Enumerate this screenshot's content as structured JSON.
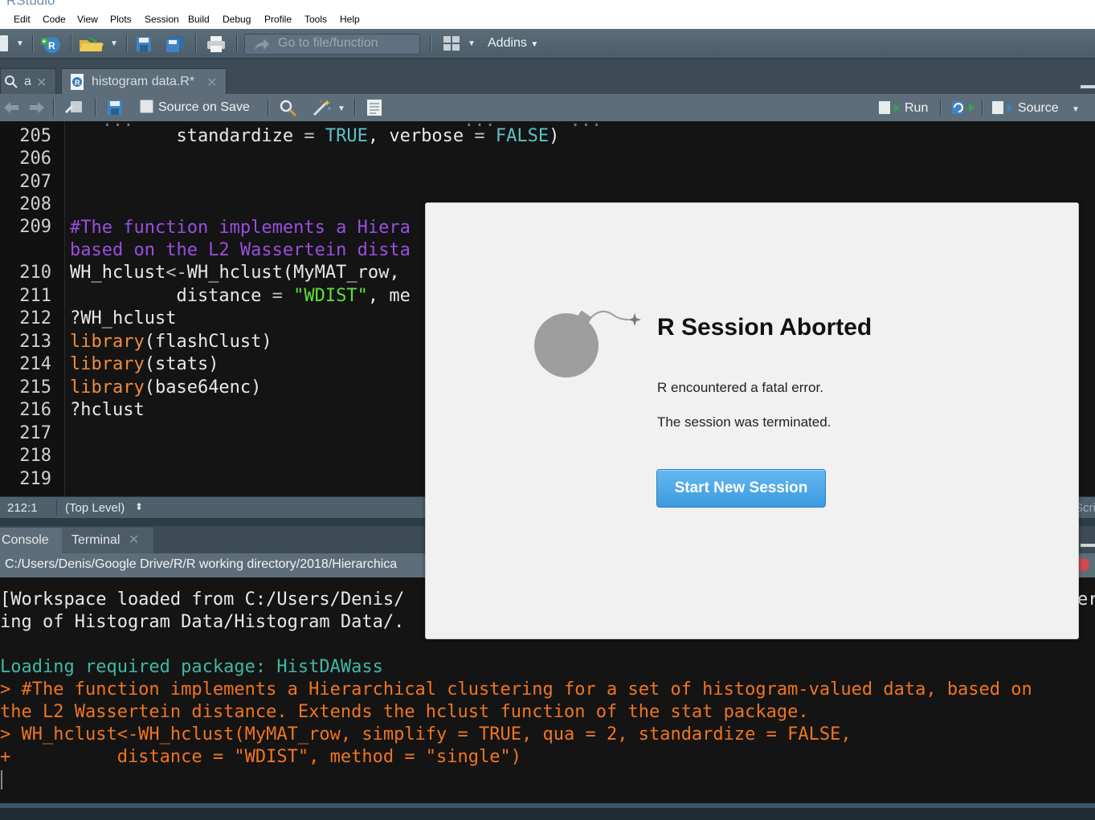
{
  "app": {
    "title": "RStudio"
  },
  "menu": [
    "Edit",
    "Code",
    "View",
    "Plots",
    "Session",
    "Build",
    "Debug",
    "Profile",
    "Tools",
    "Help"
  ],
  "toolbar": {
    "goto_placeholder": "Go to file/function",
    "addins_label": "Addins"
  },
  "editor_tabs": [
    {
      "label": "a",
      "active": false
    },
    {
      "label": "histogram data.R*",
      "active": true
    }
  ],
  "editor_toolbar": {
    "source_on_save": "Source on Save",
    "run": "Run",
    "source": "Source"
  },
  "editor": {
    "lines": [
      {
        "num": "205",
        "text": "          standardize = TRUE, verbose = FALSE)"
      },
      {
        "num": "206",
        "text": ""
      },
      {
        "num": "207",
        "text": ""
      },
      {
        "num": "208",
        "text": ""
      },
      {
        "num": "209",
        "text": "#The function implements a Hiera"
      },
      {
        "num": "",
        "text": "based on the L2 Wassertein dista"
      },
      {
        "num": "210",
        "text": "WH_hclust<-WH_hclust(MyMAT_row,"
      },
      {
        "num": "211",
        "text": "          distance = \"WDIST\", me"
      },
      {
        "num": "212",
        "text": "?WH_hclust"
      },
      {
        "num": "213",
        "text": "library(flashClust)"
      },
      {
        "num": "214",
        "text": "library(stats)"
      },
      {
        "num": "215",
        "text": "library(base64enc)"
      },
      {
        "num": "216",
        "text": "?hclust"
      },
      {
        "num": "217",
        "text": ""
      },
      {
        "num": "218",
        "text": ""
      },
      {
        "num": "219",
        "text": ""
      }
    ]
  },
  "status": {
    "position": "212:1",
    "scope": "(Top Level)",
    "right": "Scri"
  },
  "console_tabs": [
    {
      "label": "Console",
      "active": true
    },
    {
      "label": "Terminal",
      "active": false
    }
  ],
  "console": {
    "path": "C:/Users/Denis/Google Drive/R/R working directory/2018/Hierarchica",
    "lines": [
      {
        "text": "[Workspace loaded from C:/Users/Denis/",
        "style": "white"
      },
      {
        "text": "ing of Histogram Data/Histogram Data/.",
        "style": "white"
      },
      {
        "text": "",
        "style": "white"
      },
      {
        "text": "Loading required package: HistDAWass",
        "style": "teal"
      },
      {
        "text": "> #The function implements a Hierarchical clustering for a set of histogram-valued data, based on",
        "style": "orange"
      },
      {
        "text": "the L2 Wassertein distance. Extends the hclust function of the stat package.",
        "style": "orange"
      },
      {
        "text": "> WH_hclust<-WH_hclust(MyMAT_row, simplify = TRUE, qua = 2, standardize = FALSE,",
        "style": "orange"
      },
      {
        "text": "+          distance = \"WDIST\", method = \"single\")",
        "style": "orange"
      }
    ],
    "overflow_right": "er"
  },
  "modal": {
    "title": "R Session Aborted",
    "message1": "R encountered a fatal error.",
    "message2": "The session was terminated.",
    "button": "Start New Session",
    "icon": "bomb-icon"
  }
}
